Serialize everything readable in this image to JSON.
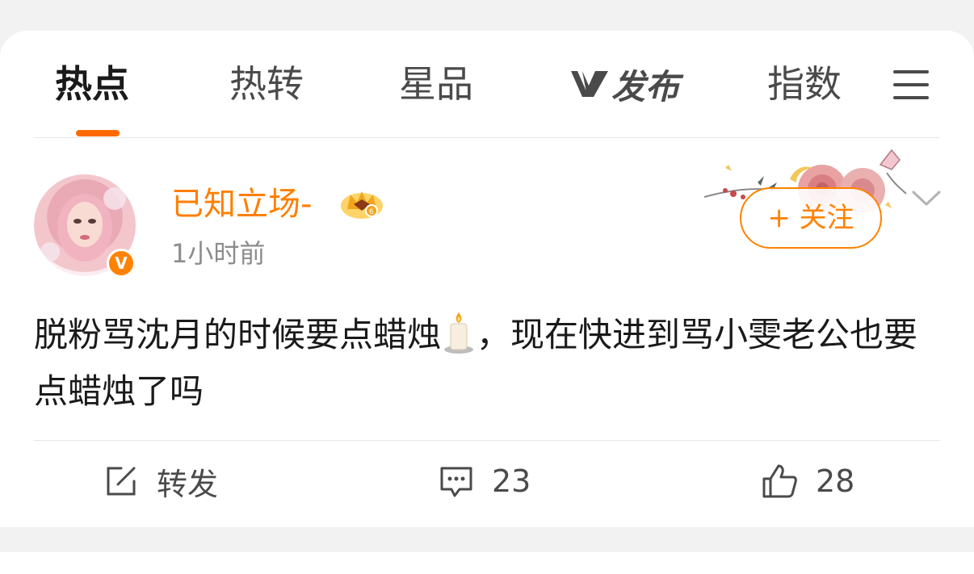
{
  "tabs": {
    "items": [
      {
        "label": "热点",
        "active": true
      },
      {
        "label": "热转",
        "active": false
      },
      {
        "label": "星品",
        "active": false
      },
      {
        "label": "指数",
        "active": false
      }
    ],
    "brand_tab": {
      "glyph": "V",
      "label": "发布"
    },
    "menu_icon": "menu-icon"
  },
  "post": {
    "author": {
      "name": "已知立场-",
      "verified_mark": "V",
      "badge_icon": "crown-icon"
    },
    "time": "1小时前",
    "follow_label": "+ 关注",
    "text_part1": "脱粉骂沈月的时候要点蜡烛",
    "text_part2": "，现在快进到骂小雯老公也要点蜡烛了吗",
    "emoji": "candle-icon",
    "actions": {
      "repost_label": "转发",
      "comment_count": "23",
      "like_count": "28"
    }
  },
  "colors": {
    "accent": "#ff8200",
    "username": "#ff7f00",
    "tab_underline": "#ff6a00",
    "text": "#1a1a1a",
    "muted": "#8c8c8c"
  }
}
